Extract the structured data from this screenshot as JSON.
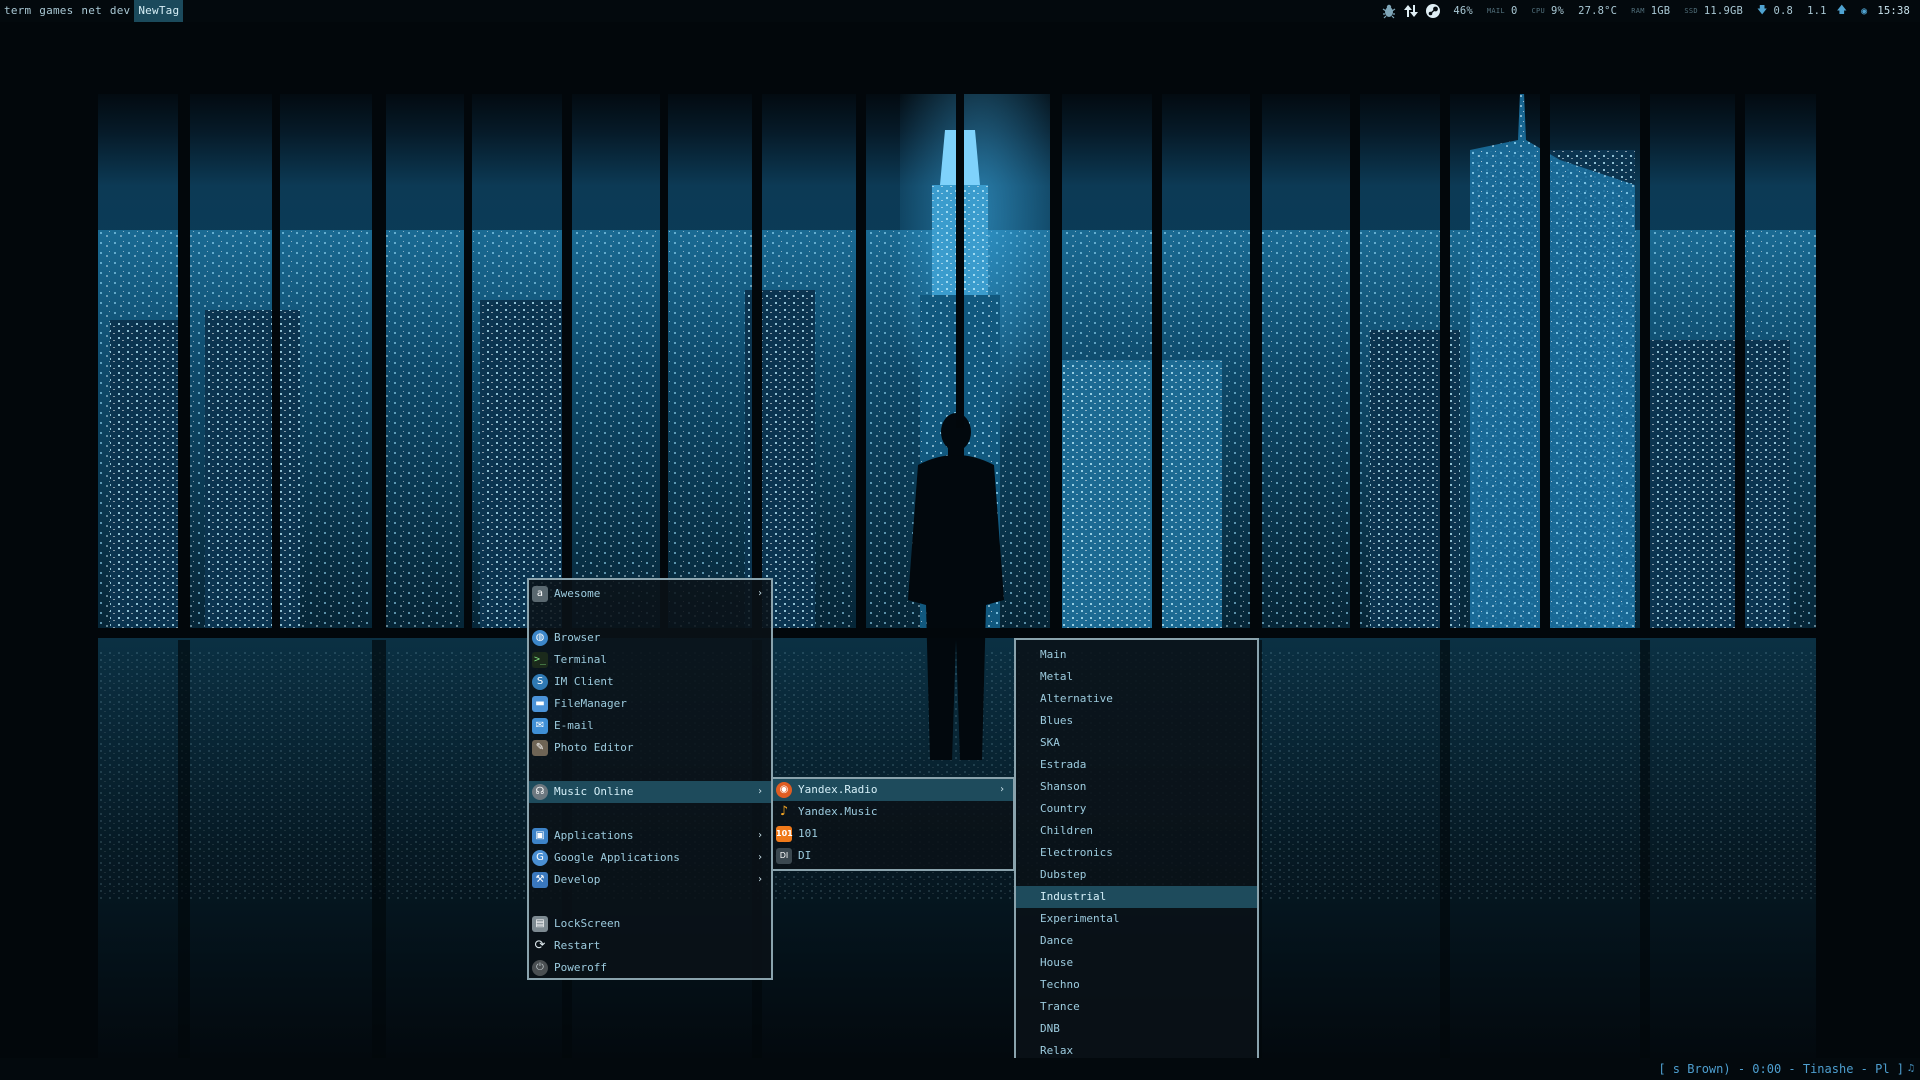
{
  "topbar": {
    "tags": [
      "term",
      "games",
      "net",
      "dev",
      "NewTag"
    ],
    "active_tag": "NewTag",
    "status": {
      "icons": [
        "bug-icon",
        "up-down-arrows-icon",
        "steam-icon"
      ],
      "battery": "46%",
      "mail_label": "MAIL",
      "mail_value": "0",
      "cpu_label": "CPU",
      "cpu_value": "9%",
      "cpu_temp": "27.8°C",
      "ram_label": "RAM",
      "ram_value": "1GB",
      "ssd_label": "SSD",
      "ssd_value": "11.9GB",
      "net_down": "0.8",
      "net_up": "1.1",
      "clock": "15:38"
    }
  },
  "main_menu": {
    "items": [
      {
        "label": "Awesome",
        "icon": "awesome-icon",
        "submenu": true
      },
      {
        "label": "Browser",
        "icon": "browser-icon",
        "submenu": false
      },
      {
        "label": "Terminal",
        "icon": "terminal-icon",
        "submenu": false
      },
      {
        "label": "IM Client",
        "icon": "im-client-icon",
        "submenu": false
      },
      {
        "label": "FileManager",
        "icon": "folder-icon",
        "submenu": false
      },
      {
        "label": "E-mail",
        "icon": "mail-icon",
        "submenu": false
      },
      {
        "label": "Photo Editor",
        "icon": "photo-editor-icon",
        "submenu": false
      },
      {
        "label": "Music Online",
        "icon": "headphones-icon",
        "submenu": true,
        "highlighted": true
      },
      {
        "label": "Applications",
        "icon": "applications-icon",
        "submenu": true
      },
      {
        "label": "Google Applications",
        "icon": "google-icon",
        "submenu": true
      },
      {
        "label": "Develop",
        "icon": "develop-icon",
        "submenu": true
      },
      {
        "label": "LockScreen",
        "icon": "lock-icon",
        "submenu": false
      },
      {
        "label": "Restart",
        "icon": "restart-icon",
        "submenu": false
      },
      {
        "label": "Poweroff",
        "icon": "power-icon",
        "submenu": false
      }
    ]
  },
  "music_menu": {
    "items": [
      {
        "label": "Yandex.Radio",
        "icon": "yandex-radio-icon",
        "submenu": true,
        "highlighted": true
      },
      {
        "label": "Yandex.Music",
        "icon": "yandex-music-icon",
        "submenu": false
      },
      {
        "label": "101",
        "icon": "101-icon",
        "submenu": false
      },
      {
        "label": "DI",
        "icon": "di-icon",
        "submenu": false
      }
    ]
  },
  "radio_menu": {
    "items": [
      "Main",
      "Metal",
      "Alternative",
      "Blues",
      "SKA",
      "Estrada",
      "Shanson",
      "Country",
      "Children",
      "Electronics",
      "Dubstep",
      "Industrial",
      "Experimental",
      "Dance",
      "House",
      "Techno",
      "Trance",
      "DNB",
      "Relax"
    ],
    "highlighted": "Industrial"
  },
  "bottombar": {
    "now_playing": "[ s Brown) - 0:00 - Tinashe - Pl ]"
  },
  "colors": {
    "accent": "#1e4b5c",
    "menu_text": "#9ccbde",
    "bar_bg": "#03090d",
    "now_playing": "#4e9fd0"
  }
}
